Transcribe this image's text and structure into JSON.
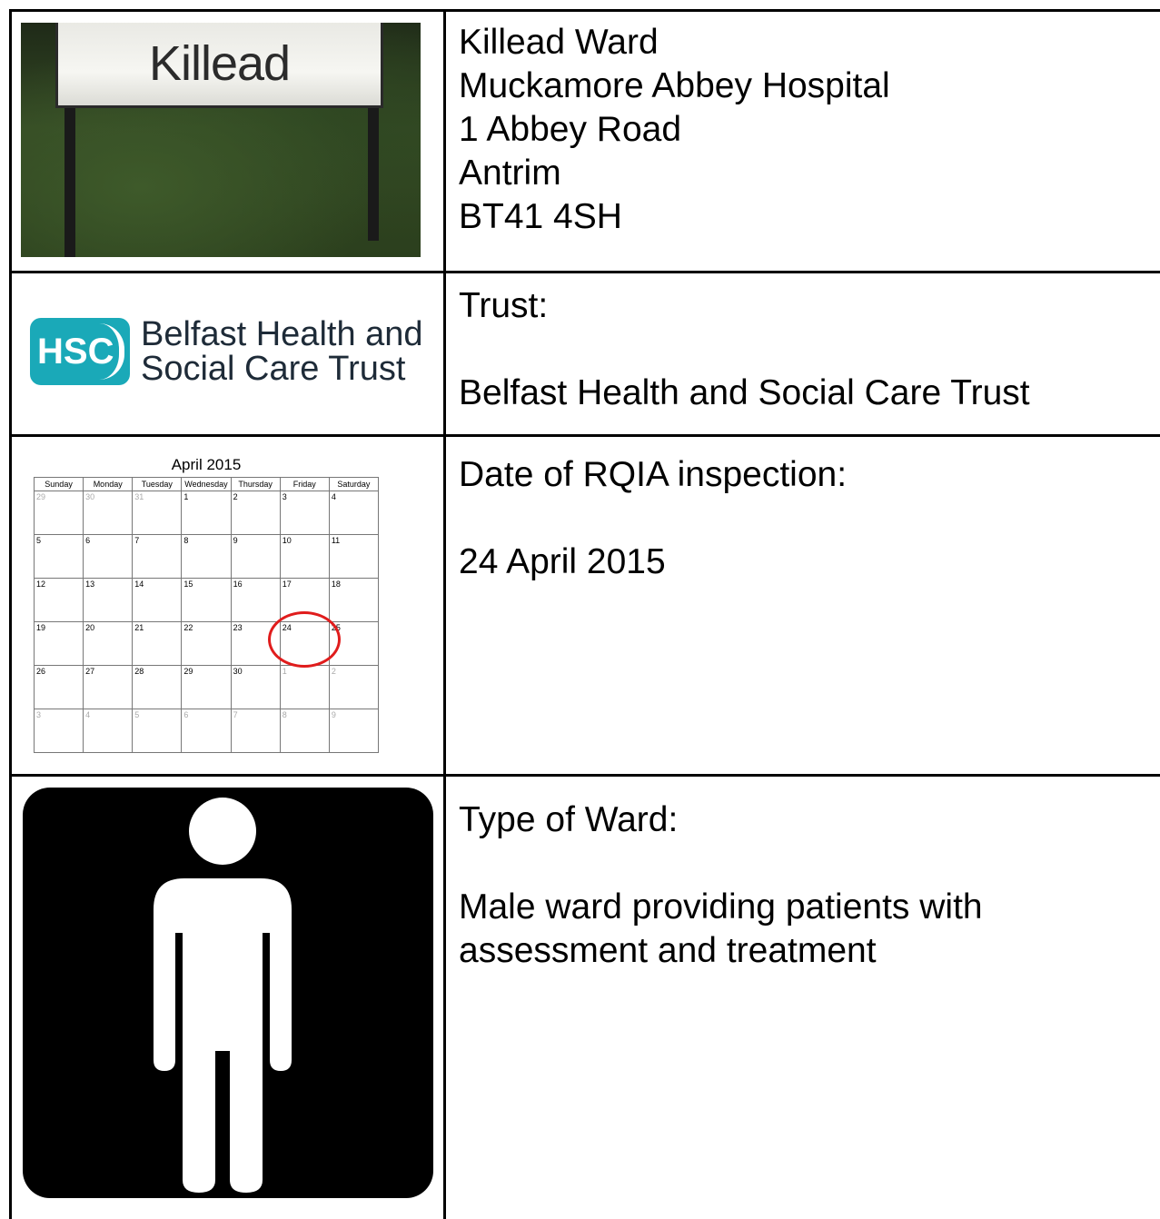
{
  "rows": [
    {
      "image": {
        "sign_text": "Killead"
      },
      "lines": [
        "Killead Ward",
        "Muckamore Abbey Hospital",
        "1 Abbey Road",
        "Antrim",
        "BT41 4SH"
      ]
    },
    {
      "image": {
        "logo_badge": "HSC",
        "logo_line1": "Belfast Health and",
        "logo_line2": "Social Care Trust"
      },
      "label": "Trust:",
      "value": "Belfast  Health and Social Care Trust"
    },
    {
      "image": {
        "calendar_title": "April 2015",
        "weekdays": [
          "Sunday",
          "Monday",
          "Tuesday",
          "Wednesday",
          "Thursday",
          "Friday",
          "Saturday"
        ],
        "weeks": [
          [
            "29",
            "30",
            "31",
            "1",
            "2",
            "3",
            "4"
          ],
          [
            "5",
            "6",
            "7",
            "8",
            "9",
            "10",
            "11"
          ],
          [
            "12",
            "13",
            "14",
            "15",
            "16",
            "17",
            "18"
          ],
          [
            "19",
            "20",
            "21",
            "22",
            "23",
            "24",
            "25"
          ],
          [
            "26",
            "27",
            "28",
            "29",
            "30",
            "1",
            "2"
          ],
          [
            "3",
            "4",
            "5",
            "6",
            "7",
            "8",
            "9"
          ]
        ],
        "circled_day": "24",
        "circle_color": "#e01c1c"
      },
      "label": "Date of RQIA inspection:",
      "value": "24 April 2015"
    },
    {
      "image": {
        "icon": "male-person-icon"
      },
      "label": "Type of Ward:",
      "value_lines": [
        "Male ward providing patients with",
        "assessment and treatment"
      ]
    }
  ],
  "colors": {
    "hsc_teal": "#1aa9b8",
    "border": "#000000"
  }
}
